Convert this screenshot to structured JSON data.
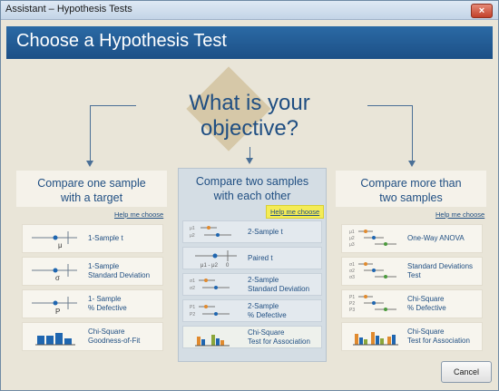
{
  "window": {
    "title": "Assistant – Hypothesis Tests",
    "close_symbol": "×"
  },
  "header": {
    "title": "Choose a Hypothesis Test"
  },
  "objective": "What is your objective?",
  "columns": [
    {
      "title_line1": "Compare one sample",
      "title_line2": "with a target",
      "help": "Help me choose",
      "cards": [
        {
          "line1": "1-Sample t",
          "line2": ""
        },
        {
          "line1": "1-Sample",
          "line2": "Standard Deviation"
        },
        {
          "line1": "1- Sample",
          "line2": "% Defective"
        },
        {
          "line1": "Chi-Square",
          "line2": "Goodness-of-Fit"
        }
      ]
    },
    {
      "title_line1": "Compare two samples",
      "title_line2": "with each other",
      "help": "Help me choose",
      "cards": [
        {
          "line1": "2-Sample t",
          "line2": ""
        },
        {
          "line1": "Paired t",
          "line2": ""
        },
        {
          "line1": "2-Sample",
          "line2": "Standard Deviation"
        },
        {
          "line1": "2-Sample",
          "line2": "% Defective"
        },
        {
          "line1": "Chi-Square",
          "line2": "Test for Association"
        }
      ]
    },
    {
      "title_line1": "Compare more than",
      "title_line2": "two samples",
      "help": "Help me choose",
      "cards": [
        {
          "line1": "One-Way ANOVA",
          "line2": ""
        },
        {
          "line1": "Standard Deviations",
          "line2": "Test"
        },
        {
          "line1": "Chi-Square",
          "line2": "% Defective"
        },
        {
          "line1": "Chi-Square",
          "line2": "Test for Association"
        }
      ]
    }
  ],
  "icon_text": {
    "mu": "μ",
    "sigma": "σ",
    "p": "P",
    "mu1": "μ1",
    "mu2": "μ2",
    "mu_diff": "μ1 - μ2",
    "zero": "0",
    "sigma1": "σ1",
    "sigma2": "σ2",
    "p1": "P1",
    "p2": "P2",
    "mu3": "μ3",
    "sigma3": "σ3",
    "p3": "P3"
  },
  "buttons": {
    "cancel": "Cancel"
  },
  "colors": {
    "header": "#1c4f86",
    "accent_text": "#1f4e82",
    "highlight": "#f4ec56",
    "diamond": "#d6c8a8"
  }
}
